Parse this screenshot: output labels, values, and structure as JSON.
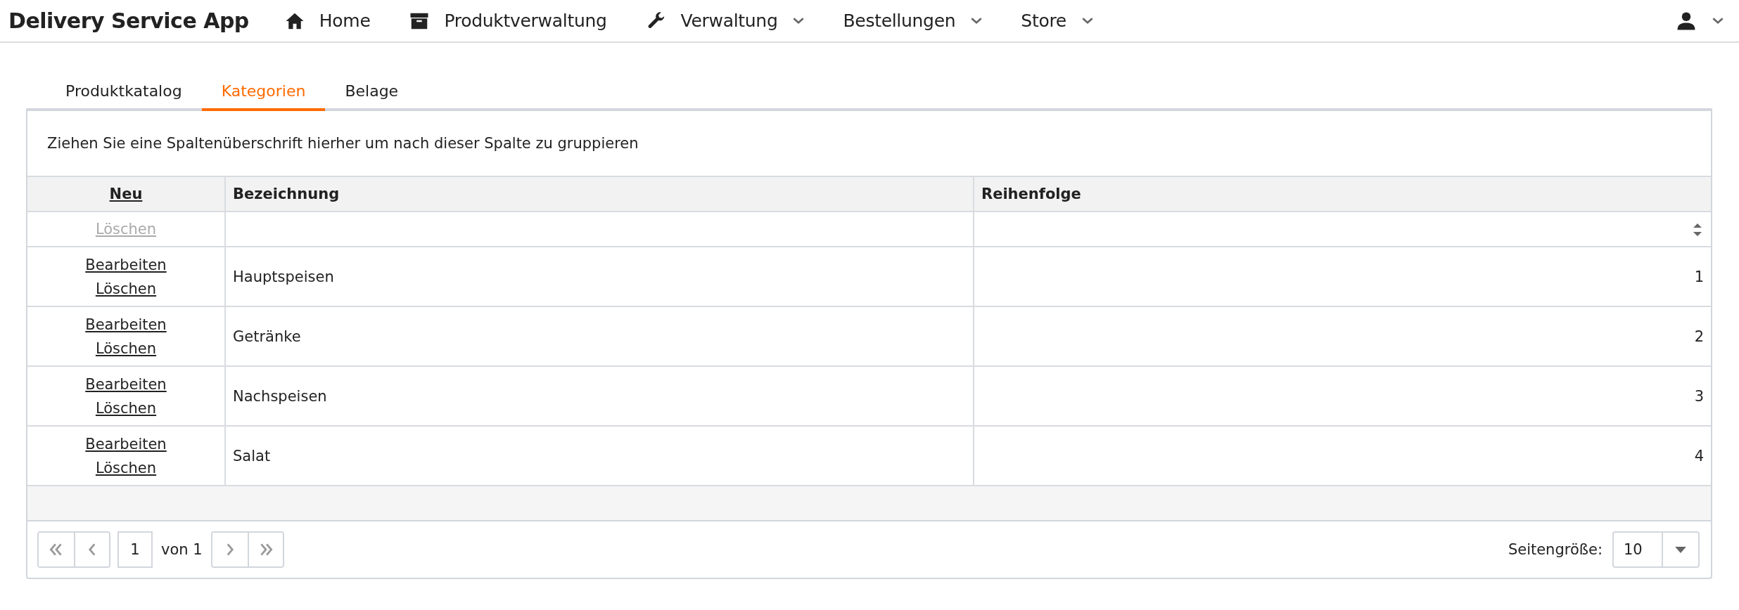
{
  "app_title": "Delivery Service App",
  "nav": [
    {
      "label": "Home",
      "kind": "home",
      "dropdown": false
    },
    {
      "label": "Produktverwaltung",
      "kind": "box",
      "dropdown": false
    },
    {
      "label": "Verwaltung",
      "kind": "wrench",
      "dropdown": true
    },
    {
      "label": "Bestellungen",
      "kind": "plain",
      "dropdown": true
    },
    {
      "label": "Store",
      "kind": "plain",
      "dropdown": true
    }
  ],
  "tabs": [
    {
      "label": "Produktkatalog",
      "selected": false
    },
    {
      "label": "Kategorien",
      "selected": true
    },
    {
      "label": "Belage",
      "selected": false
    }
  ],
  "grid": {
    "group_panel": "Ziehen Sie eine Spaltenüberschrift hierher um nach dieser Spalte zu gruppieren",
    "new_link": "Neu",
    "columns": [
      "Bezeichnung",
      "Reihenfolge"
    ],
    "filter_row": {
      "delete": "Löschen",
      "disabled": true
    },
    "rows": [
      {
        "edit": "Bearbeiten",
        "delete": "Löschen",
        "name": "Hauptspeisen",
        "order": "1"
      },
      {
        "edit": "Bearbeiten",
        "delete": "Löschen",
        "name": "Getränke",
        "order": "2"
      },
      {
        "edit": "Bearbeiten",
        "delete": "Löschen",
        "name": "Nachspeisen",
        "order": "3"
      },
      {
        "edit": "Bearbeiten",
        "delete": "Löschen",
        "name": "Salat",
        "order": "4"
      }
    ],
    "pager": {
      "page": "1",
      "of": "von 1",
      "page_size_label": "Seitengröße:",
      "page_size": "10"
    }
  }
}
